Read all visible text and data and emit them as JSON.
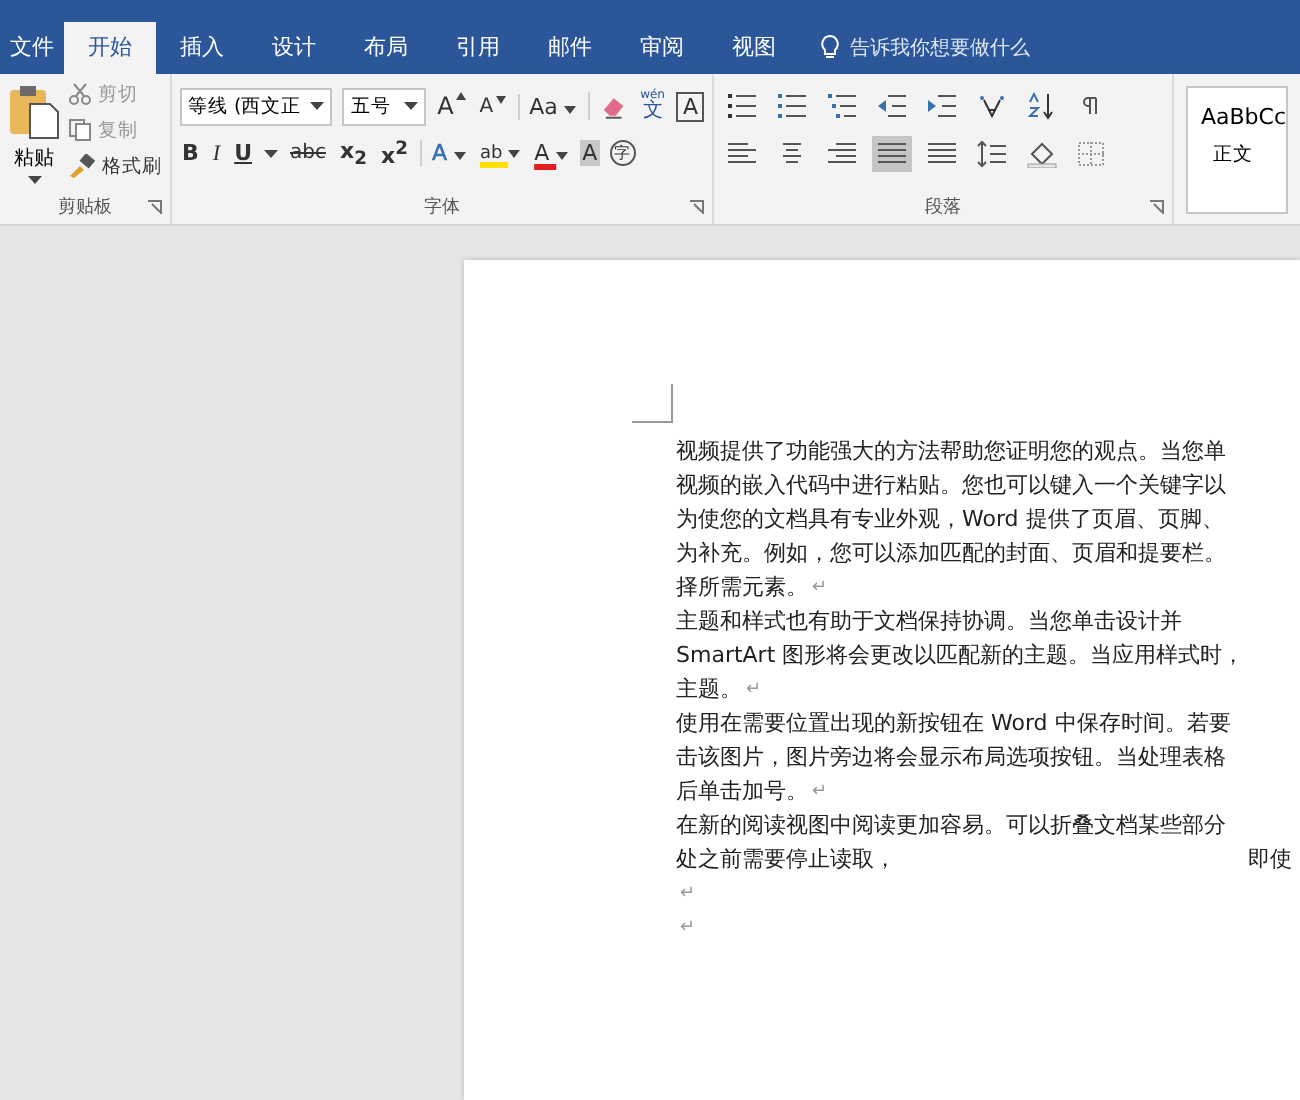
{
  "tabs": [
    {
      "label": "文件",
      "selected": false
    },
    {
      "label": "开始",
      "selected": true
    },
    {
      "label": "插入",
      "selected": false
    },
    {
      "label": "设计",
      "selected": false
    },
    {
      "label": "布局",
      "selected": false
    },
    {
      "label": "引用",
      "selected": false
    },
    {
      "label": "邮件",
      "selected": false
    },
    {
      "label": "审阅",
      "selected": false
    },
    {
      "label": "视图",
      "selected": false
    }
  ],
  "tell_me": {
    "placeholder": "告诉我你想要做什么"
  },
  "clipboard": {
    "paste": "粘贴",
    "items": [
      {
        "kind": "cut",
        "label": "剪切",
        "disabled": true
      },
      {
        "kind": "copy",
        "label": "复制",
        "disabled": true
      },
      {
        "kind": "brush",
        "label": "格式刷",
        "disabled": false
      }
    ],
    "group_label": "剪贴板"
  },
  "font": {
    "name": "等线 (西文正",
    "size": "五号",
    "group_label": "字体",
    "row1": [
      {
        "kind": "grow",
        "text": "A"
      },
      {
        "kind": "shrink",
        "text": "A"
      },
      {
        "kind": "case",
        "text": "Aa"
      },
      {
        "kind": "clear"
      },
      {
        "kind": "phonetic",
        "text": "文",
        "ruby": "wén"
      },
      {
        "kind": "border",
        "text": "A"
      }
    ],
    "row2": [
      {
        "kind": "bold",
        "text": "B"
      },
      {
        "kind": "italic",
        "text": "I"
      },
      {
        "kind": "underline",
        "text": "U"
      },
      {
        "kind": "strike",
        "text": "abc"
      },
      {
        "kind": "script",
        "text": "x$_{2}$"
      },
      {
        "kind": "script",
        "text": "x$^{2}$"
      },
      {
        "kind": "effect",
        "text": "A"
      },
      {
        "kind": "highlight",
        "text": "ab"
      },
      {
        "kind": "color",
        "text": "A"
      },
      {
        "kind": "shade",
        "text": "A"
      },
      {
        "kind": "enclose",
        "text": "字"
      }
    ]
  },
  "paragraph": {
    "group_label": "段落",
    "row1": [
      {
        "kind": "bullets",
        "selected": false
      },
      {
        "kind": "numbering",
        "selected": false
      },
      {
        "kind": "multilevel",
        "selected": false
      },
      {
        "kind": "outdent",
        "selected": false
      },
      {
        "kind": "indent",
        "selected": false
      },
      {
        "kind": "asian",
        "selected": false
      },
      {
        "kind": "sort",
        "selected": false
      },
      {
        "kind": "marks",
        "selected": false
      }
    ],
    "row2": [
      {
        "kind": "left",
        "selected": false
      },
      {
        "kind": "center",
        "selected": false
      },
      {
        "kind": "right",
        "selected": false
      },
      {
        "kind": "justify",
        "selected": true
      },
      {
        "kind": "distribute",
        "selected": false
      },
      {
        "kind": "spacing",
        "selected": false
      },
      {
        "kind": "fill",
        "selected": false
      },
      {
        "kind": "borders",
        "selected": false
      }
    ]
  },
  "styles": {
    "sample": "AaBbCc",
    "name": "正文"
  },
  "document": {
    "end_mark": "↵",
    "lines": [
      {
        "text": "视频提供了功能强大的方法帮助您证明您的观点。当您单",
        "end": false
      },
      {
        "text": "视频的嵌入代码中进行粘贴。您也可以键入一个关键字以",
        "end": false
      },
      {
        "text": "为使您的文档具有专业外观，Word 提供了页眉、页脚、",
        "end": false
      },
      {
        "text": "为补充。例如，您可以添加匹配的封面、页眉和提要栏。",
        "end": false
      },
      {
        "text": "择所需元素。",
        "end": true
      },
      {
        "text": "主题和样式也有助于文档保持协调。当您单击设计并",
        "end": false
      },
      {
        "text": "SmartArt 图形将会更改以匹配新的主题。当应用样式时，",
        "end": false
      },
      {
        "text": "主题。",
        "end": true
      },
      {
        "text": "使用在需要位置出现的新按钮在 Word 中保存时间。若要",
        "end": false
      },
      {
        "text": "击该图片，图片旁边将会显示布局选项按钮。当处理表格",
        "end": false
      },
      {
        "text": "后单击加号。",
        "end": true
      },
      {
        "text": "在新的阅读视图中阅读更加容易。可以折叠文档某些部分",
        "end": false
      },
      {
        "text": "处之前需要停止读取，",
        "tail": "即使",
        "end": false
      },
      {
        "end": true
      },
      {
        "end": true
      }
    ]
  }
}
